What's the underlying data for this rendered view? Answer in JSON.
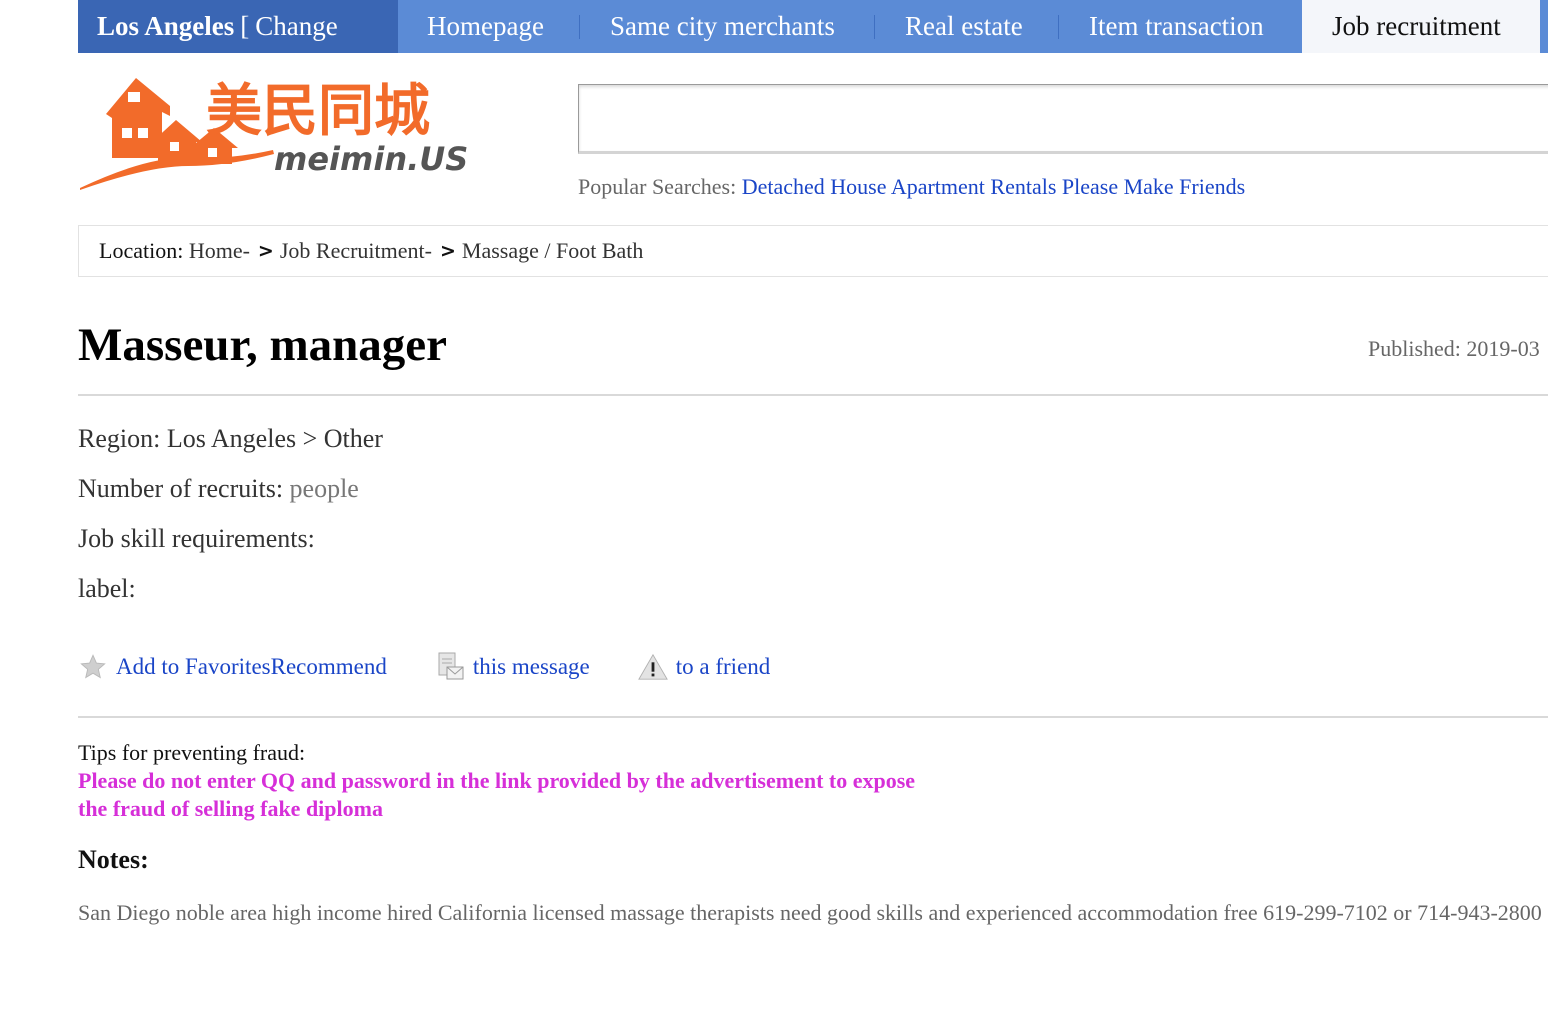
{
  "nav": {
    "city": "Los Angeles",
    "city_bracket": "[",
    "change": "Change",
    "items": [
      "Homepage",
      "Same city merchants",
      "Real estate",
      "Item transaction",
      "Job recruitment"
    ],
    "active": "Job recruitment"
  },
  "logo": {
    "chinese": "美民同城",
    "domain": "meimin.US"
  },
  "search": {
    "value": "",
    "popular_label": "Popular Searches:",
    "popular_links": [
      "Detached House",
      "Apartment Rentals",
      "Please Make Friends"
    ]
  },
  "breadcrumb": {
    "label": "Location:",
    "items": [
      "Home-",
      "Job Recruitment-",
      "Massage / Foot Bath"
    ]
  },
  "post": {
    "title": "Masseur, manager",
    "published": "Published: 2019-03",
    "region_label": "Region:",
    "region_value": "Los Angeles > Other",
    "recruits_label": "Number of recruits:",
    "recruits_value": "people",
    "skills_label": "Job skill requirements:",
    "label_label": "label:"
  },
  "actions": {
    "favorites": "Add to FavoritesRecommend",
    "message": "this message",
    "friend": "to a friend"
  },
  "tips": {
    "title": "Tips for preventing fraud:",
    "text": "Please do not enter QQ and password in the link provided by the advertisement to expose the fraud of selling fake diploma"
  },
  "notes": {
    "title": "Notes:",
    "text": "San Diego noble area high income hired California licensed massage therapists need good skills and experienced accommodation free 619-299-7102 or 714-943-2800"
  },
  "colors": {
    "nav_blue": "#5b8bd6",
    "city_blue": "#3a66b4",
    "link_blue": "#1a45c7",
    "logo_orange": "#f26b2a",
    "tips_magenta": "#d62fd8"
  }
}
